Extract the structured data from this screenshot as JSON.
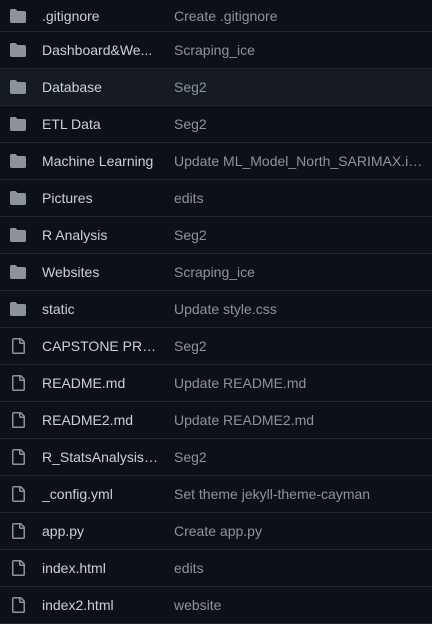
{
  "colors": {
    "background": "#0d1117",
    "hover_row": "#161b22",
    "divider": "#21262d",
    "icon": "#8b949e",
    "file_name": "#c9d1d9",
    "commit_message": "#8b949e"
  },
  "files": [
    {
      "icon": "folder-icon",
      "name": ".gitignore",
      "commit_message": "Create .gitignore"
    },
    {
      "icon": "folder-icon",
      "name": "Dashboard&We...",
      "commit_message": "Scraping_ice"
    },
    {
      "icon": "folder-icon",
      "name": "Database",
      "commit_message": "Seg2"
    },
    {
      "icon": "folder-icon",
      "name": "ETL Data",
      "commit_message": "Seg2"
    },
    {
      "icon": "folder-icon",
      "name": "Machine Learning",
      "commit_message": "Update ML_Model_North_SARIMAX.ip..."
    },
    {
      "icon": "folder-icon",
      "name": "Pictures",
      "commit_message": "edits"
    },
    {
      "icon": "folder-icon",
      "name": "R Analysis",
      "commit_message": "Seg2"
    },
    {
      "icon": "folder-icon",
      "name": "Websites",
      "commit_message": "Scraping_ice"
    },
    {
      "icon": "folder-icon",
      "name": "static",
      "commit_message": "Update style.css"
    },
    {
      "icon": "file-icon",
      "name": "CAPSTONE PROJ...",
      "commit_message": "Seg2"
    },
    {
      "icon": "file-icon",
      "name": "README.md",
      "commit_message": "Update README.md"
    },
    {
      "icon": "file-icon",
      "name": "README2.md",
      "commit_message": "Update README2.md"
    },
    {
      "icon": "file-icon",
      "name": "R_StatsAnalysis o...",
      "commit_message": "Seg2"
    },
    {
      "icon": "file-icon",
      "name": "_config.yml",
      "commit_message": "Set theme jekyll-theme-cayman"
    },
    {
      "icon": "file-icon",
      "name": "app.py",
      "commit_message": "Create app.py"
    },
    {
      "icon": "file-icon",
      "name": "index.html",
      "commit_message": "edits"
    },
    {
      "icon": "file-icon",
      "name": "index2.html",
      "commit_message": "website"
    }
  ]
}
